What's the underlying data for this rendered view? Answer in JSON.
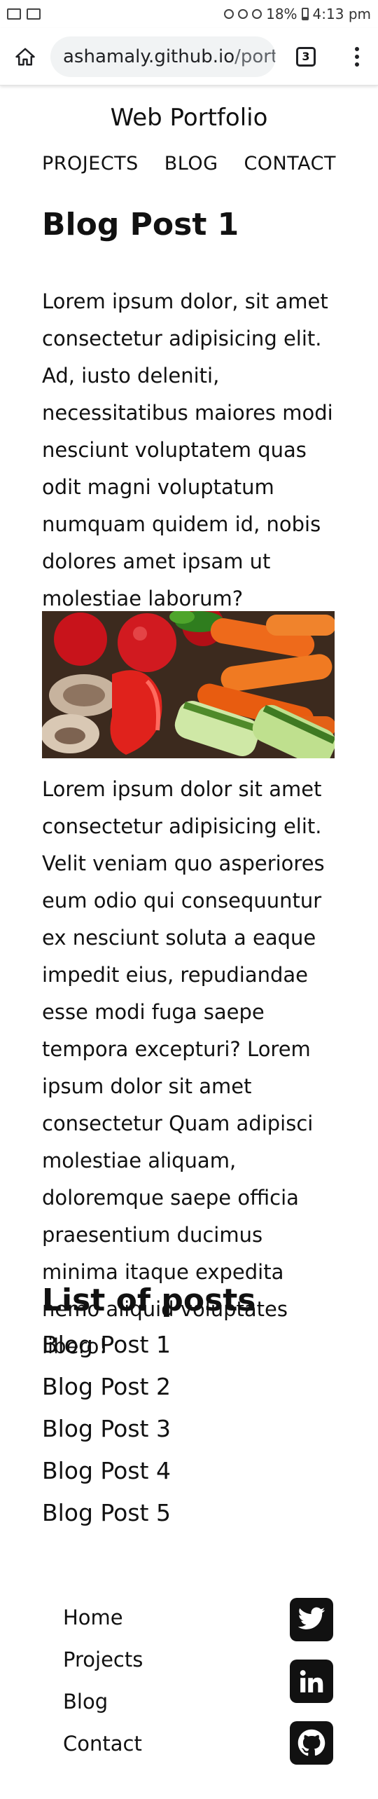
{
  "status_bar": {
    "battery": "18%",
    "time": "4:13 pm"
  },
  "browser": {
    "url_host": "ashamaly.github.io",
    "url_path": "/portfolio",
    "tab_count": "3"
  },
  "site": {
    "title": "Web Portfolio",
    "nav": [
      "PROJECTS",
      "BLOG",
      "CONTACT"
    ]
  },
  "post": {
    "title": "Blog Post 1",
    "paragraph1": "Lorem ipsum dolor, sit amet consectetur adipisicing elit. Ad, iusto deleniti, necessitatibus maiores modi nesciunt voluptatem quas odit magni voluptatum numquam quidem id, nobis dolores amet ipsam ut molestiae laborum?",
    "paragraph2": "Lorem ipsum dolor sit amet consectetur adipisicing elit. Velit veniam quo asperiores eum odio qui consequuntur ex nesciunt soluta a eaque impedit eius, repudiandae esse modi fuga saepe tempora excepturi? Lorem ipsum dolor sit amet consectetur Quam adipisci molestiae aliquam, doloremque saepe officia praesentium ducimus minima itaque expedita nemo aliquid voluptates libero!"
  },
  "posts_list": {
    "heading": "List of posts",
    "items": [
      "Blog Post 1",
      "Blog Post 2",
      "Blog Post 3",
      "Blog Post 4",
      "Blog Post 5"
    ]
  },
  "footer": {
    "links": [
      "Home",
      "Projects",
      "Blog",
      "Contact"
    ],
    "social_icons": [
      "twitter-icon",
      "linkedin-icon",
      "github-icon"
    ]
  }
}
